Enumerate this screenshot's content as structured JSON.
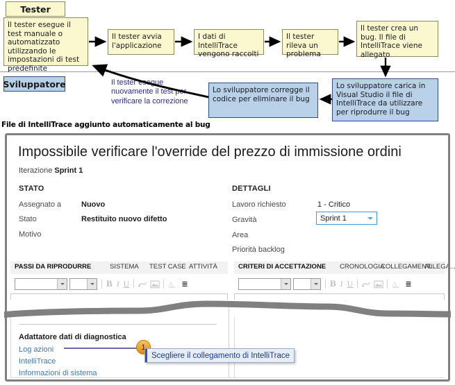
{
  "flowchart": {
    "lanes": [
      {
        "id": "tester",
        "label": "Tester"
      },
      {
        "id": "sviluppatore",
        "label": "Sviluppatore"
      }
    ],
    "boxes": [
      {
        "id": "b1",
        "text": "Il tester esegue il test manuale o automatizzato utilizzando le impostazioni di test predefinite",
        "color": "#FBF8D0"
      },
      {
        "id": "b2",
        "text": "Il tester avvia l'applicazione",
        "color": "#FBF8D0"
      },
      {
        "id": "b3",
        "text": "I dati di IntelliTrace vengono raccolti",
        "color": "#FBF8D0"
      },
      {
        "id": "b4",
        "text": "Il tester rileva un problema",
        "color": "#FBF8D0"
      },
      {
        "id": "b5",
        "text": "Il tester crea un bug. Il file di IntelliTrace viene allegato",
        "color": "#FBF8D0"
      },
      {
        "id": "b6",
        "text": "Lo sviluppatore carica in Visual Studio il file di IntelliTrace da utilizzare per riprodurre il bug",
        "color": "#B8D0E8"
      },
      {
        "id": "b7",
        "text": "Lo sviluppatore corregge il codice per eliminare il bug",
        "color": "#B8D0E8"
      }
    ],
    "note": "Il tester esegue nuovamente il test per verificare la correzione",
    "note_color": "#2A2A8C",
    "caption": "File di IntelliTrace aggiunto automaticamente al bug"
  },
  "workitem": {
    "title": "Impossibile verificare l'override del prezzo di immissione ordini",
    "iteration_label": "Iterazione",
    "iteration_value": "Sprint 1",
    "stato": {
      "heading": "STATO",
      "fields": [
        {
          "label": "Assegnato a",
          "value": "Nuovo"
        },
        {
          "label": "Stato",
          "value": "Restituito nuovo difetto"
        },
        {
          "label": "Motivo",
          "value": ""
        }
      ]
    },
    "dettagli": {
      "heading": "DETTAGLI",
      "fields": [
        {
          "label": "Lavoro richiesto",
          "value": "1 - Critico"
        },
        {
          "label": "Gravità",
          "value": "Sprint 1",
          "control": "combobox"
        },
        {
          "label": "Area",
          "value": ""
        },
        {
          "label": "Priorità backlog",
          "value": ""
        }
      ]
    },
    "left_tabs": [
      {
        "label": "PASSI DA RIPRODURRE",
        "active": true
      },
      {
        "label": "SISTEMA",
        "active": false
      },
      {
        "label": "TEST CASE",
        "active": false
      },
      {
        "label": "ATTIVITÀ",
        "active": false
      }
    ],
    "right_tabs": [
      {
        "label": "CRITERI DI ACCETTAZIONE",
        "active": true
      },
      {
        "label": "CRONOLOGIA",
        "active": false
      },
      {
        "label": "COLLEGAMENTI",
        "active": false
      },
      {
        "label": "ALLEGA....",
        "active": false
      }
    ],
    "toolbar": {
      "font_family_value": "",
      "font_size_value": "",
      "bold": "B",
      "italic": "I",
      "underline": "U",
      "overflow": "⩲"
    }
  },
  "diagnostics": {
    "title": "Adattatore dati di diagnostica",
    "links": [
      "Log azioni",
      "IntelliTrace",
      "Informazioni di sistema"
    ],
    "link_color": "#3C78B4"
  },
  "callout": {
    "number": "1",
    "text": "Scegliere il collegamento di IntelliTrace",
    "badge_color": "#E08A06"
  }
}
